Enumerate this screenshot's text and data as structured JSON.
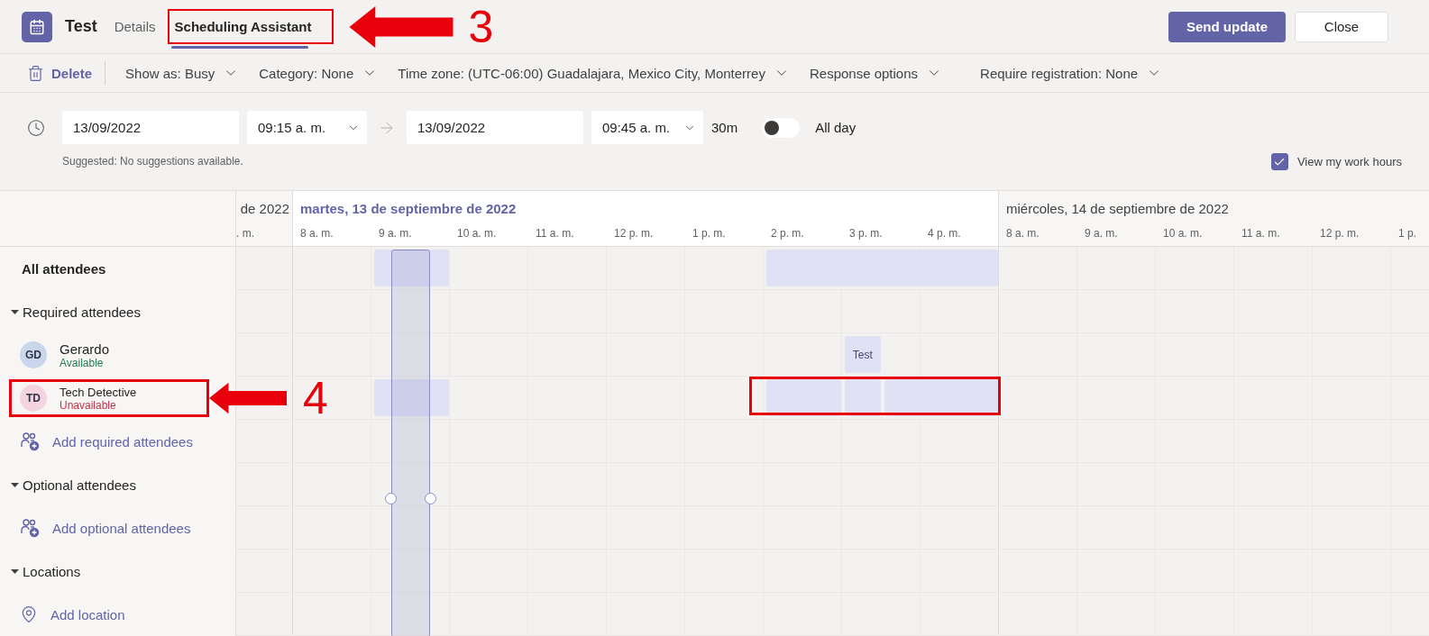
{
  "header": {
    "title": "Test",
    "tabs": [
      {
        "label": "Details",
        "selected": false,
        "highlighted": false
      },
      {
        "label": "Scheduling Assistant",
        "selected": true,
        "highlighted": true
      }
    ],
    "callout": "3",
    "buttons": [
      {
        "label": "Send update",
        "kind": "primary"
      },
      {
        "label": "Close",
        "kind": "secondary"
      }
    ]
  },
  "toolbar": {
    "delete": "Delete",
    "dropdowns": [
      "Show as: Busy",
      "Category: None",
      "Time zone: (UTC-06:00) Guadalajara, Mexico City, Monterrey",
      "Response options",
      "Require registration: None"
    ]
  },
  "time": {
    "start_date": "13/09/2022",
    "start_time": "09:15 a. m.",
    "end_date": "13/09/2022",
    "end_time": "09:45 a. m.",
    "duration": "30m",
    "all_day": {
      "label": "All day",
      "on": false
    },
    "suggestion": "Suggested: No suggestions available.",
    "work_hours": {
      "label": "View my work hours",
      "checked": true
    }
  },
  "schedule": {
    "days": [
      {
        "label": "de 2022",
        "selected": false,
        "hours": [
          ". m."
        ]
      },
      {
        "label": "martes, 13 de septiembre de 2022",
        "selected": true,
        "hours": [
          "8 a. m.",
          "9 a. m.",
          "10 a. m.",
          "11 a. m.",
          "12 p. m.",
          "1 p. m.",
          "2 p. m.",
          "3 p. m.",
          "4 p. m."
        ]
      },
      {
        "label": "miércoles, 14 de septiembre de 2022",
        "selected": false,
        "hours": [
          "8 a. m.",
          "9 a. m.",
          "10 a. m.",
          "11 a. m.",
          "12 p. m.",
          "1 p."
        ]
      }
    ],
    "rows": [
      {
        "kind": "heading",
        "label": "All attendees"
      },
      {
        "kind": "section",
        "label": "Required attendees",
        "expanded": true
      },
      {
        "kind": "attendee",
        "initials": "GD",
        "name": "Gerardo",
        "status": "Available",
        "available": true,
        "color": "#c9d6ec",
        "highlighted": false,
        "event": "Test"
      },
      {
        "kind": "attendee",
        "initials": "TD",
        "name": "Tech Detective",
        "status": "Unavailable",
        "available": false,
        "color": "#f4d4df",
        "highlighted": true,
        "callout": "4"
      },
      {
        "kind": "add-attendee",
        "label": "Add required attendees"
      },
      {
        "kind": "section",
        "label": "Optional attendees",
        "expanded": true
      },
      {
        "kind": "add-attendee",
        "label": "Add optional attendees"
      },
      {
        "kind": "section",
        "label": "Locations",
        "expanded": true
      },
      {
        "kind": "add-location",
        "label": "Add location"
      }
    ]
  }
}
